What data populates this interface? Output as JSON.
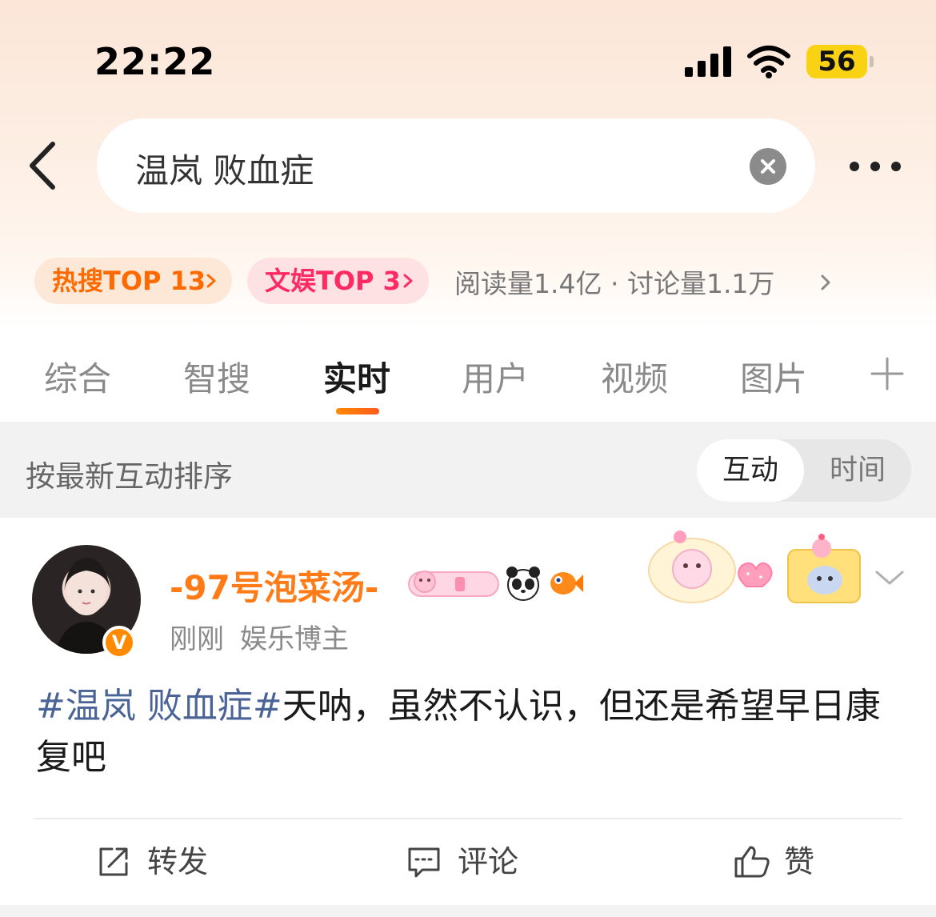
{
  "status_bar": {
    "time": "22:22",
    "battery": "56"
  },
  "search": {
    "query": "温岚 败血症"
  },
  "rank_chips": {
    "hot": "热搜TOP 13",
    "entertainment": "文娱TOP 3",
    "stats": "阅读量1.4亿 · 讨论量1.1万"
  },
  "tabs": [
    {
      "label": "综合"
    },
    {
      "label": "智搜"
    },
    {
      "label": "实时"
    },
    {
      "label": "用户"
    },
    {
      "label": "视频"
    },
    {
      "label": "图片"
    }
  ],
  "active_tab": "实时",
  "sort": {
    "title": "按最新互动排序",
    "option_active": "互动",
    "option_other": "时间"
  },
  "post": {
    "username": "-97号泡菜汤-",
    "time": "刚刚",
    "role": "娱乐博主",
    "verified_mark": "V",
    "hashtag": "#温岚 败血症#",
    "text": "天呐，虽然不认识，但还是希望早日康复吧"
  },
  "actions": {
    "repost": "转发",
    "comment": "评论",
    "like": "赞"
  },
  "colors": {
    "accent_orange": "#ff7b18",
    "hot_chip": "#ff6a00",
    "ent_chip": "#ff2a63",
    "hashtag": "#4a6497"
  }
}
